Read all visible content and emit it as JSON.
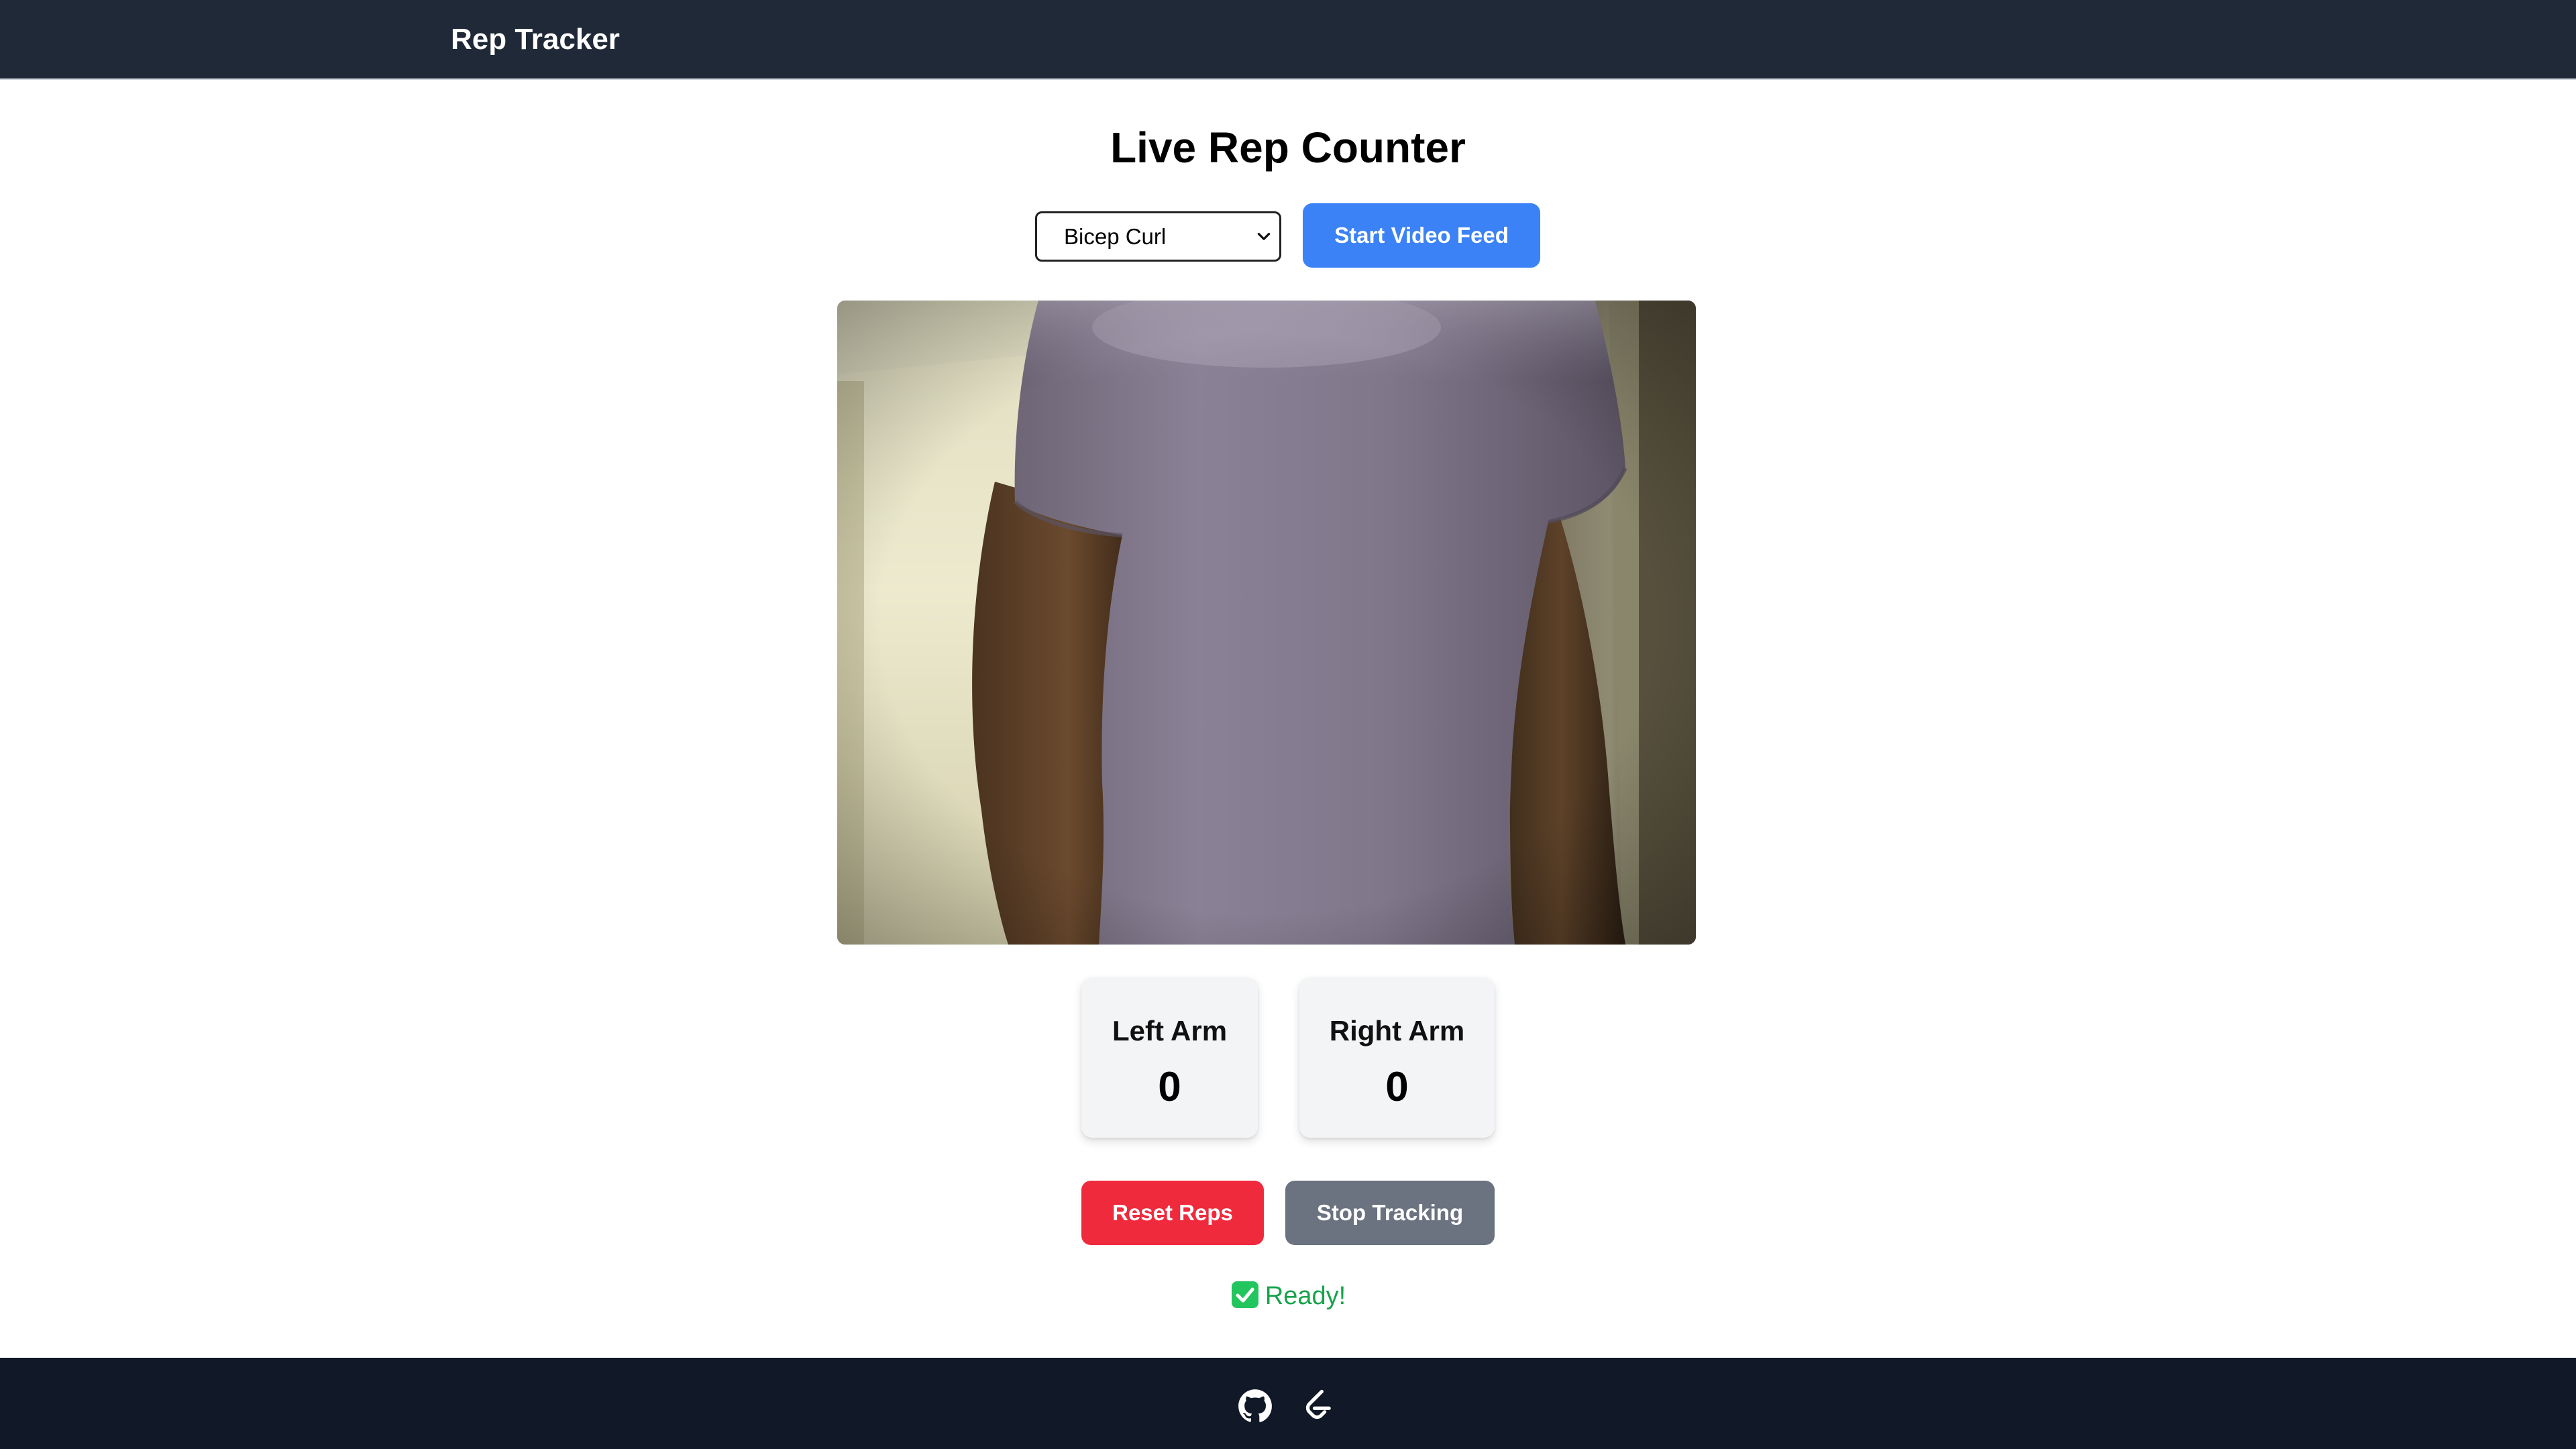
{
  "navbar": {
    "brand": "Rep Tracker"
  },
  "main": {
    "title": "Live Rep Counter",
    "exercise_select": {
      "selected": "Bicep Curl"
    },
    "start_button_label": "Start Video Feed",
    "counters": [
      {
        "label": "Left Arm",
        "value": "0"
      },
      {
        "label": "Right Arm",
        "value": "0"
      }
    ],
    "reset_button_label": "Reset Reps",
    "stop_button_label": "Stop Tracking",
    "status": {
      "icon": "check-mark-button-icon",
      "text": "Ready!"
    }
  },
  "footer": {
    "icons": [
      "github-icon",
      "leetcode-icon"
    ]
  },
  "colors": {
    "navbar_bg": "#1f2937",
    "footer_bg": "#111827",
    "start_button": "#3b82f6",
    "reset_button": "#ef2a3c",
    "stop_button": "#6b7280",
    "status_text": "#16a34a",
    "card_bg": "#f3f4f6"
  }
}
